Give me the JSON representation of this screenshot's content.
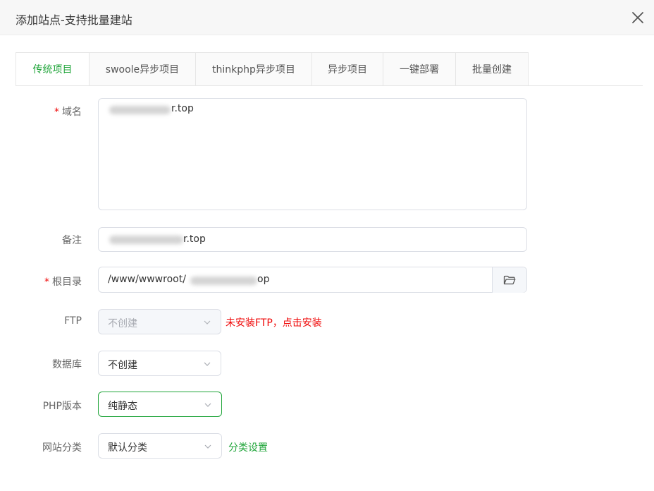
{
  "dialog": {
    "title": "添加站点-支持批量建站"
  },
  "tabs": [
    {
      "label": "传统项目",
      "active": true
    },
    {
      "label": "swoole异步项目",
      "active": false
    },
    {
      "label": "thinkphp异步项目",
      "active": false
    },
    {
      "label": "异步项目",
      "active": false
    },
    {
      "label": "一键部署",
      "active": false
    },
    {
      "label": "批量创建",
      "active": false
    }
  ],
  "form": {
    "domain": {
      "label": "域名",
      "required_mark": "*",
      "value_suffix": "r.top"
    },
    "remark": {
      "label": "备注",
      "value_suffix": "r.top"
    },
    "root": {
      "label": "根目录",
      "required_mark": "*",
      "value_prefix": "/www/wwwroot/",
      "value_suffix": "op",
      "button_icon": "folder-icon"
    },
    "ftp": {
      "label": "FTP",
      "selected": "不创建",
      "disabled": true,
      "notice": "未安装FTP，点击安装"
    },
    "database": {
      "label": "数据库",
      "selected": "不创建"
    },
    "php": {
      "label": "PHP版本",
      "selected": "纯静态"
    },
    "category": {
      "label": "网站分类",
      "selected": "默认分类",
      "link": "分类设置"
    }
  },
  "colors": {
    "accent": "#20a53a",
    "danger": "#ef0808",
    "border": "#dcdfe6"
  }
}
